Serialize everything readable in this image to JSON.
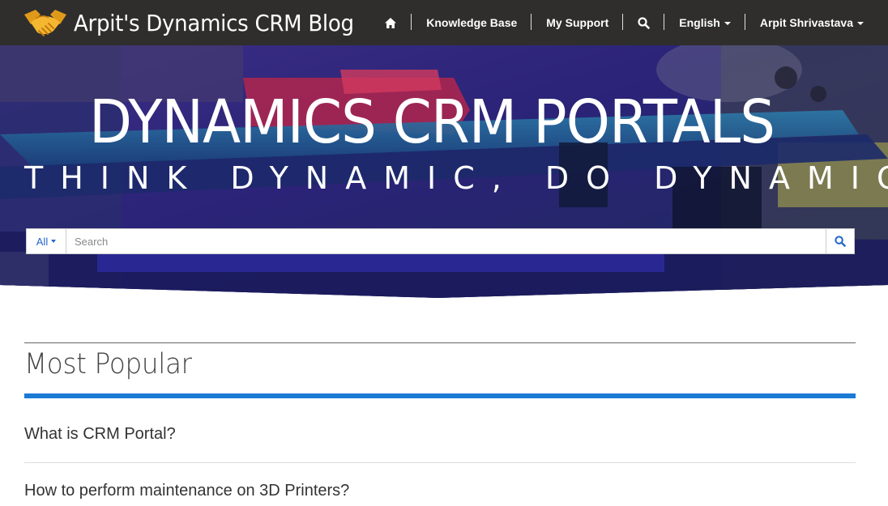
{
  "brand": {
    "title": "Arpit's Dynamics CRM Blog",
    "logo_icon": "handshake-icon"
  },
  "nav": {
    "home_icon": "home-icon",
    "knowledge_base": "Knowledge Base",
    "my_support": "My Support",
    "search_icon": "search-icon",
    "language": "English",
    "user": "Arpit Shrivastava"
  },
  "hero": {
    "title": "DYNAMICS CRM PORTALS",
    "subtitle": "THINK DYNAMIC, DO DYNAMIC"
  },
  "search": {
    "scope": "All",
    "placeholder": "Search",
    "button_icon": "search-icon"
  },
  "popular": {
    "heading": "Most Popular",
    "items": [
      "What is CRM Portal?",
      "How to perform maintenance on 3D Printers?"
    ]
  },
  "colors": {
    "navbar": "#2f2e2d",
    "accent": "#1a7ad4",
    "link": "#2266cc",
    "hero_tint": "#2c2579"
  }
}
